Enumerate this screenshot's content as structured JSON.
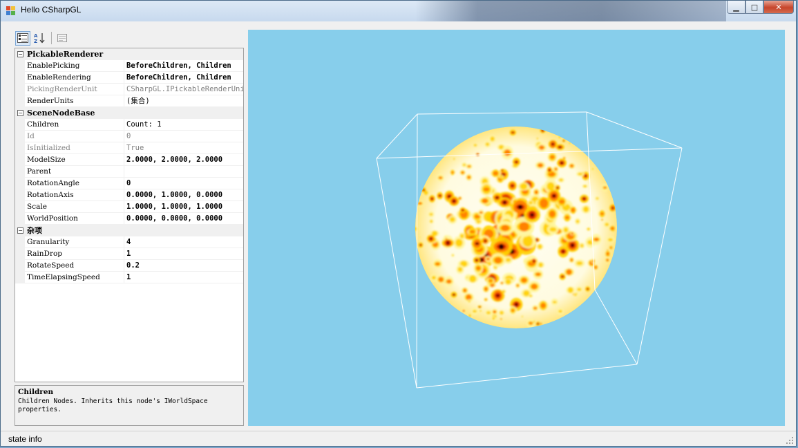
{
  "window": {
    "title": "Hello CSharpGL",
    "controls": {
      "minimize": "▁",
      "maximize": "□",
      "close": "✕"
    }
  },
  "toolbar": {
    "categorized_icon": "categorized-view-icon",
    "alphabetical_icon": "alphabetical-sort-icon",
    "property_pages_icon": "property-pages-icon"
  },
  "property_grid": {
    "categories": [
      {
        "name": "PickableRenderer",
        "rows": [
          {
            "name": "EnablePicking",
            "value": "BeforeChildren, Children",
            "bold": true,
            "disabled": false
          },
          {
            "name": "EnableRendering",
            "value": "BeforeChildren, Children",
            "bold": true,
            "disabled": false
          },
          {
            "name": "PickingRenderUnit",
            "value": "CSharpGL.IPickableRenderUnit",
            "bold": false,
            "disabled": true
          },
          {
            "name": "RenderUnits",
            "value": "(集合)",
            "bold": false,
            "disabled": false
          }
        ]
      },
      {
        "name": "SceneNodeBase",
        "rows": [
          {
            "name": "Children",
            "value": "Count: 1",
            "bold": false,
            "disabled": false
          },
          {
            "name": "Id",
            "value": "0",
            "bold": false,
            "disabled": true
          },
          {
            "name": "IsInitialized",
            "value": "True",
            "bold": false,
            "disabled": true
          },
          {
            "name": "ModelSize",
            "value": "2.0000, 2.0000, 2.0000",
            "bold": true,
            "disabled": false
          },
          {
            "name": "Parent",
            "value": "",
            "bold": false,
            "disabled": false
          },
          {
            "name": "RotationAngle",
            "value": "0",
            "bold": true,
            "disabled": false
          },
          {
            "name": "RotationAxis",
            "value": "0.0000, 1.0000, 0.0000",
            "bold": true,
            "disabled": false
          },
          {
            "name": "Scale",
            "value": "1.0000, 1.0000, 1.0000",
            "bold": true,
            "disabled": false
          },
          {
            "name": "WorldPosition",
            "value": "0.0000, 0.0000, 0.0000",
            "bold": true,
            "disabled": false
          }
        ]
      },
      {
        "name": "杂项",
        "rows": [
          {
            "name": "Granularity",
            "value": "4",
            "bold": true,
            "disabled": false
          },
          {
            "name": "RainDrop",
            "value": "1",
            "bold": true,
            "disabled": false
          },
          {
            "name": "RotateSpeed",
            "value": "0.2",
            "bold": true,
            "disabled": false
          },
          {
            "name": "TimeElapsingSpeed",
            "value": "1",
            "bold": true,
            "disabled": false
          }
        ]
      }
    ]
  },
  "help": {
    "title": "Children",
    "description": "Children Nodes. Inherits this node's IWorldSpace properties."
  },
  "viewport": {
    "background": "#87ceeb",
    "bounding_box_color": "#ffffff",
    "sphere_colors": [
      "#ffffff",
      "#fff6a0",
      "#ffd000",
      "#ff7a00",
      "#d42000",
      "#5a0000",
      "#1a0000"
    ]
  },
  "status": {
    "text": "state info"
  }
}
